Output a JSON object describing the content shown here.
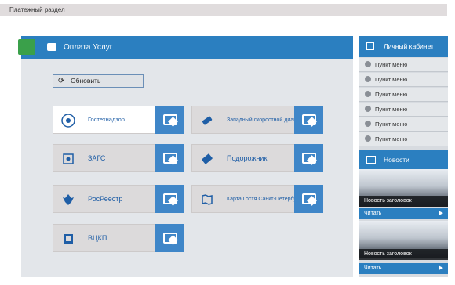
{
  "topbar": {
    "title": "Платежный раздел"
  },
  "panel": {
    "title": "Оплата Услуг",
    "refresh_label": "Обновить"
  },
  "services": [
    {
      "name": "Гостехнадзор",
      "highlighted": true,
      "icon": "emblem-icon"
    },
    {
      "name": "Западный скоростной диаметр",
      "icon": "ticket-icon"
    },
    {
      "name": "ЗАГС",
      "icon": "frame-icon"
    },
    {
      "name": "Подорожник",
      "icon": "card-icon"
    },
    {
      "name": "РосРеестр",
      "icon": "eagle-icon"
    },
    {
      "name": "Карта Гостя Санкт-Петербурга",
      "icon": "map-icon"
    },
    {
      "name": "ВЦКП",
      "icon": "vckp-logo-icon"
    }
  ],
  "sidebar": {
    "title": "Личный кабинет",
    "items": [
      {
        "label": "Пункт меню"
      },
      {
        "label": "Пункт меню"
      },
      {
        "label": "Пункт меню"
      },
      {
        "label": "Пункт меню"
      },
      {
        "label": "Пункт меню"
      },
      {
        "label": "Пункт меню"
      }
    ]
  },
  "news": {
    "title": "Новости",
    "items": [
      {
        "caption": "Новость заголовок",
        "read": "Читать"
      },
      {
        "caption": "Новость заголовок",
        "read": "Читать"
      }
    ]
  },
  "colors": {
    "accent": "#2b7fc0",
    "pay_button": "#3f86c8",
    "badge": "#3aa04a"
  }
}
